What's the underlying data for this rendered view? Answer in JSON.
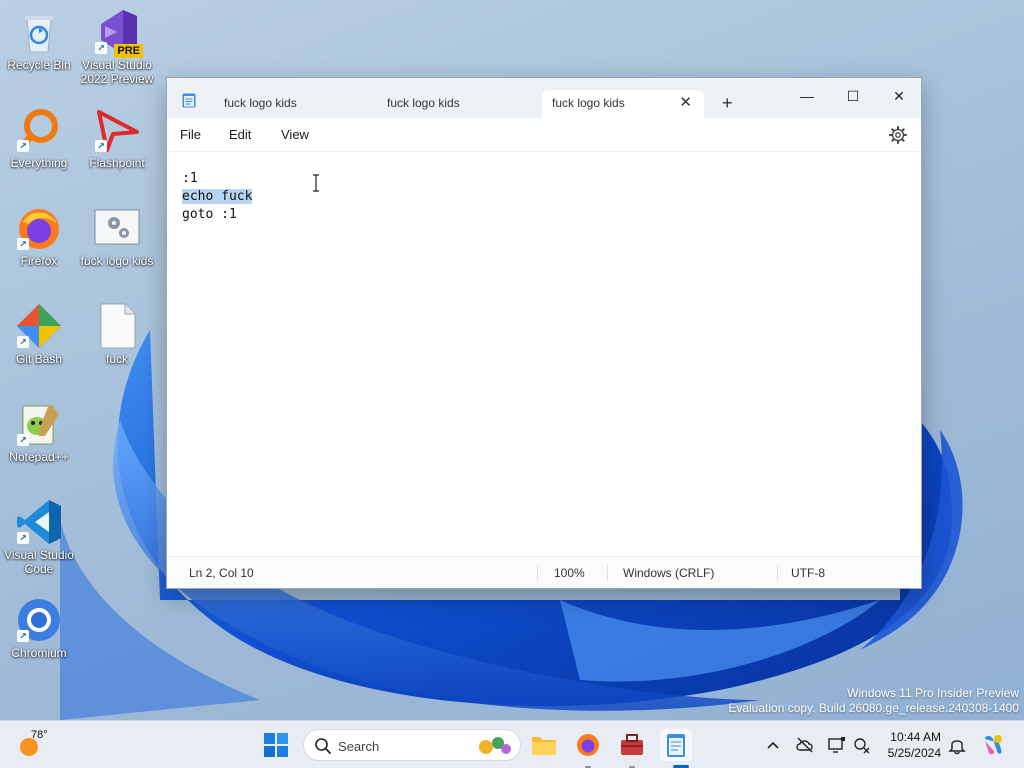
{
  "desktop": {
    "icons": [
      {
        "label": "Recycle Bin",
        "name": "recycle-bin"
      },
      {
        "label": "Visual Studio 2022 Preview",
        "name": "visual-studio-preview",
        "badge": "PRE"
      },
      {
        "label": "Everything",
        "name": "everything"
      },
      {
        "label": "Flashpoint",
        "name": "flashpoint"
      },
      {
        "label": "Firefox",
        "name": "firefox"
      },
      {
        "label": "fuck logo kids",
        "name": "batch-file"
      },
      {
        "label": "Git Bash",
        "name": "git-bash"
      },
      {
        "label": "fuck",
        "name": "text-file"
      },
      {
        "label": "Notepad++",
        "name": "notepad-plus-plus"
      },
      {
        "label": "Visual Studio Code",
        "name": "vscode"
      },
      {
        "label": "Chromium",
        "name": "chromium"
      }
    ],
    "watermark": {
      "line1": "Windows 11 Pro Insider Preview",
      "line2": "Evaluation copy. Build 26080.ge_release.240308-1400"
    }
  },
  "notepad": {
    "tabs": [
      {
        "label": "fuck logo kids",
        "active": false
      },
      {
        "label": "fuck logo kids",
        "active": false
      },
      {
        "label": "fuck logo kids",
        "active": true
      }
    ],
    "tab_close": "✕",
    "new_tab": "+",
    "window_controls": {
      "minimize": "—",
      "maximize": "☐",
      "close": "✕"
    },
    "menu": {
      "file": "File",
      "edit": "Edit",
      "view": "View"
    },
    "content": {
      "line1": ":1",
      "line2": "echo fuck",
      "line3": "goto :1"
    },
    "status": {
      "position": "Ln 2, Col 10",
      "zoom": "100%",
      "line_ending": "Windows (CRLF)",
      "encoding": "UTF-8"
    }
  },
  "taskbar": {
    "weather_temp": "78°",
    "search_placeholder": "Search",
    "apps": [
      "start",
      "search",
      "file-explorer",
      "firefox",
      "toolbox",
      "notepad"
    ],
    "clock": {
      "time": "10:44 AM",
      "date": "5/25/2024"
    }
  },
  "colors": {
    "accent": "#0067c0",
    "selection": "#b7d4f0",
    "wallpaper_blue": "#1a5fd0"
  }
}
